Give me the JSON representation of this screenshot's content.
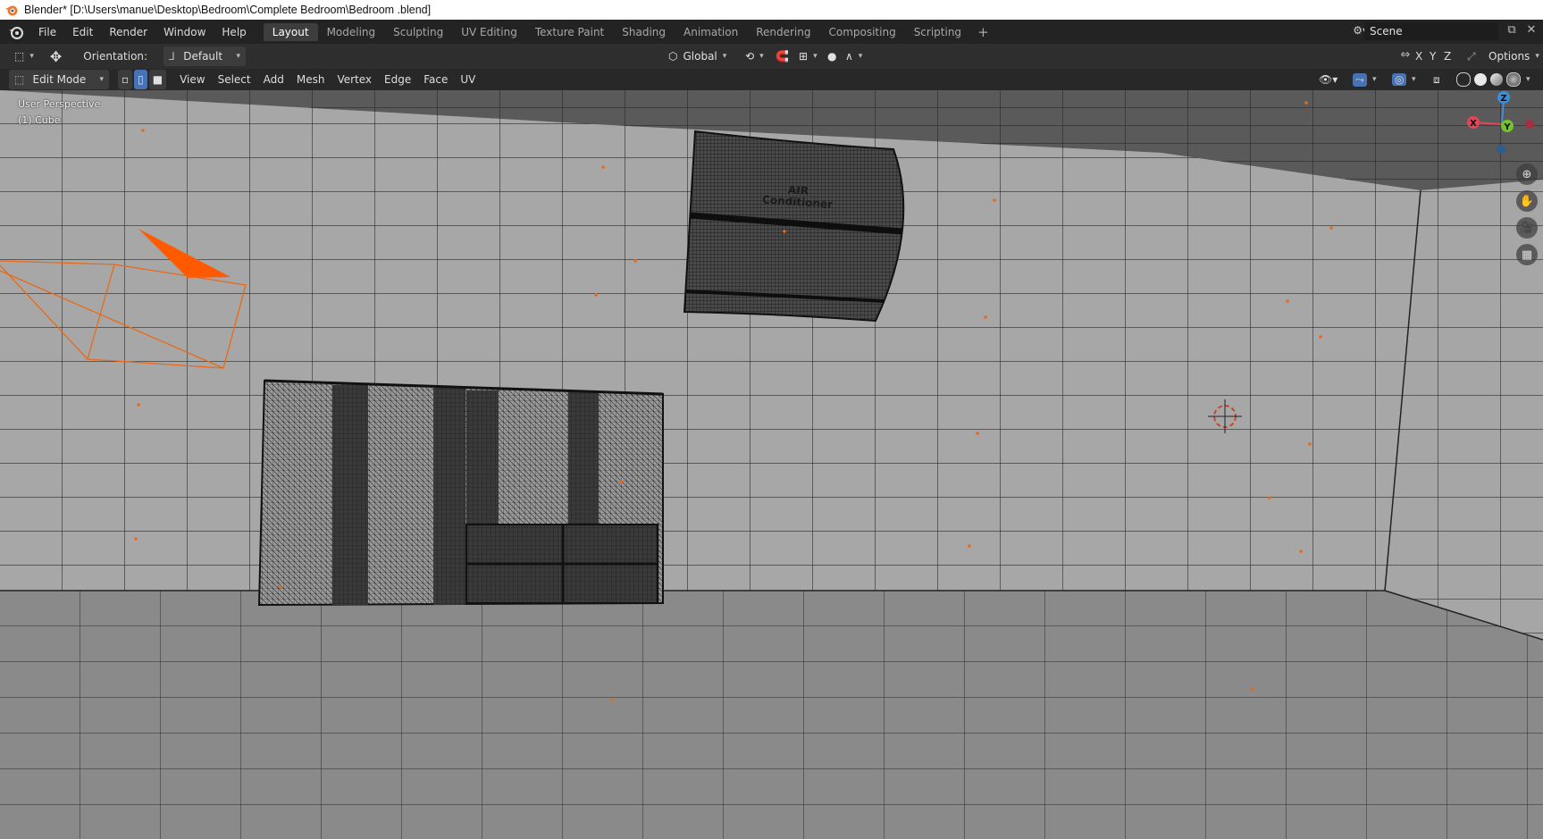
{
  "window": {
    "title": "Blender* [D:\\Users\\manue\\Desktop\\Bedroom\\Complete Bedroom\\Bedroom .blend]"
  },
  "menu": [
    "File",
    "Edit",
    "Render",
    "Window",
    "Help"
  ],
  "workspaces": [
    "Layout",
    "Modeling",
    "Sculpting",
    "UV Editing",
    "Texture Paint",
    "Shading",
    "Animation",
    "Rendering",
    "Compositing",
    "Scripting"
  ],
  "active_workspace": "Layout",
  "scene": {
    "name": "Scene"
  },
  "toolbar": {
    "orientation_label": "Orientation:",
    "orientation_value": "Default",
    "transform_space": "Global",
    "options": "Options",
    "axes": [
      "X",
      "Y",
      "Z"
    ]
  },
  "viewport_header": {
    "mode": "Edit Mode",
    "menus": [
      "View",
      "Select",
      "Add",
      "Mesh",
      "Vertex",
      "Edge",
      "Face",
      "UV"
    ]
  },
  "viewport": {
    "perspective": "User Perspective",
    "object": "(1) Cube",
    "ac_label_line1": "AIR",
    "ac_label_line2": "Conditioner"
  },
  "gizmo": {
    "x": "X",
    "y": "Y",
    "z": "Z"
  },
  "colors": {
    "accent": "#e86a17",
    "active_tab": "#3d3d3d",
    "viewport_bg": "#8d8d8d"
  }
}
